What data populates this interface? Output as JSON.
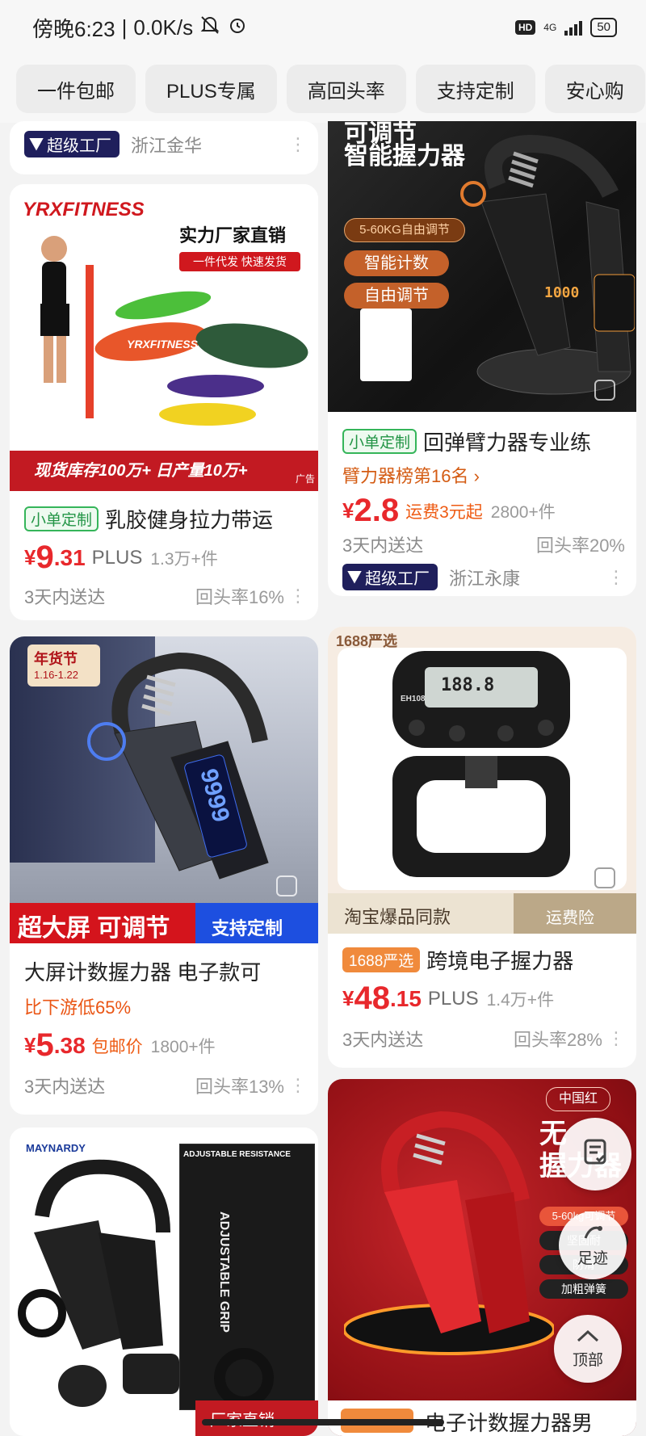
{
  "status_bar": {
    "time": "傍晚6:23",
    "speed": "0.0K/s",
    "hd": "HD",
    "network": "4G",
    "battery": "50"
  },
  "filters": [
    "一件包邮",
    "PLUS专属",
    "高回头率",
    "支持定制",
    "安心购"
  ],
  "cards": {
    "partial_top_left": {
      "badge": "超级工厂",
      "region": "浙江金华"
    },
    "grip_adjustable": {
      "image_text": {
        "line1": "可调节",
        "line2": "智能握力器",
        "pill1": "5-60KG自由调节",
        "pill2": "智能计数",
        "pill3": "自由调节",
        "display": "1000"
      },
      "tag": "小单定制",
      "title": "回弹臂力器专业练",
      "rank": "臂力器榜第16名 ›",
      "price_symbol": "¥",
      "price_int": "2.8",
      "shipping": "运费3元起",
      "sold": "2800+件",
      "delivery": "3天内送达",
      "repeat_rate": "回头率20%",
      "badge": "超级工厂",
      "region": "浙江永康"
    },
    "resistance_band": {
      "image_text": {
        "brand": "YRXFITNESS",
        "headline": "实力厂家直销",
        "sub": "一件代发 快速发货",
        "band_label": "YRXFITNESS",
        "bottom": "现货库存100万+ 日产量10万+",
        "ad": "广告"
      },
      "tag": "小单定制",
      "title": "乳胶健身拉力带运",
      "price_symbol": "¥",
      "price_int": "9",
      "price_dec": ".31",
      "plus": "PLUS",
      "sold": "1.3万+件",
      "delivery": "3天内送达",
      "repeat_rate": "回头率16%"
    },
    "big_screen_grip": {
      "image_text": {
        "festival": "年货节",
        "festival_date": "1.16-1.22",
        "display": "9999",
        "bottom_left": "超大屏 可调节",
        "bottom_right": "支持定制"
      },
      "title": "大屏计数握力器 电子款可",
      "discount": "比下游低65%",
      "price_symbol": "¥",
      "price_int": "5",
      "price_dec": ".38",
      "shipping": "包邮价",
      "sold": "1800+件",
      "delivery": "3天内送达",
      "repeat_rate": "回头率13%"
    },
    "electronic_dynamometer": {
      "image_text": {
        "corner": "1688严选",
        "model": "EH108",
        "screen": "188.8",
        "bottom_left": "淘宝爆品同款",
        "bottom_right": "运费险"
      },
      "tag": "1688严选",
      "title": "跨境电子握力器",
      "price_symbol": "¥",
      "price_int": "48",
      "price_dec": ".15",
      "plus": "PLUS",
      "sold": "1.4万+件",
      "delivery": "3天内送达",
      "repeat_rate": "回头率28%"
    },
    "maynardy_kit": {
      "image_text": {
        "brand": "MAYNARDY",
        "box_title": "ADJUSTABLE RESISTANCE",
        "box_side": "ADJUSTABLE GRIP",
        "bottom": "厂家直销"
      }
    },
    "red_grip": {
      "image_text": {
        "corner": "中国红",
        "headline1": "无",
        "headline2": "握力器",
        "pill1": "5-60kg可调节",
        "pill2": "坚固耐",
        "pill3": "防滑",
        "pill4": "加粗弹簧",
        "bottom": "电子计数握力器男"
      }
    }
  },
  "float_buttons": {
    "footprint": "足迹",
    "top": "顶部"
  },
  "colors": {
    "price_red": "#e8282c",
    "accent_orange": "#ee5a12",
    "tag_green": "#35b55a",
    "factory_navy": "#1f1f5c"
  }
}
